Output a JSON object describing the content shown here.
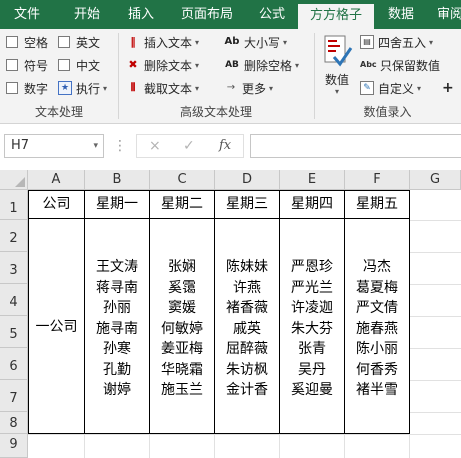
{
  "tabs": [
    "文件",
    "开始",
    "插入",
    "页面布局",
    "公式",
    "方方格子",
    "数据",
    "审阅"
  ],
  "active_tab": "方方格子",
  "ribbon": {
    "text_processing": {
      "checkboxes": [
        "空格",
        "英文",
        "符号",
        "中文",
        "数字"
      ],
      "execute_label": "执行",
      "group_label": "文本处理"
    },
    "advanced": {
      "insert_text": "插入文本",
      "delete_text": "删除文本",
      "cut_text": "截取文本",
      "case_label": "大小写",
      "delete_spaces": "删除空格",
      "more_label": "更多",
      "group_label": "高级文本处理"
    },
    "numeric": {
      "numeric_label": "数值",
      "round_label": "四舍五入",
      "keep_values": "只保留数值",
      "custom_label": "自定义",
      "plus_label": "+",
      "group_label": "数值录入"
    }
  },
  "formula_bar": {
    "name_box": "H7",
    "cancel_icon": "×",
    "enter_icon": "✓",
    "fx_label": "fx",
    "formula": ""
  },
  "columns": [
    "A",
    "B",
    "C",
    "D",
    "E",
    "F",
    "G"
  ],
  "rows": [
    "1",
    "2",
    "3",
    "4",
    "5",
    "6",
    "7",
    "8",
    "9"
  ],
  "table": {
    "headers": [
      "公司",
      "星期一",
      "星期二",
      "星期三",
      "星期四",
      "星期五"
    ],
    "company": "一公司",
    "schedule": [
      [
        "王文涛",
        "蒋寻南",
        "孙丽",
        "施寻南",
        "孙寒",
        "孔勤",
        "谢婷"
      ],
      [
        "张娴",
        "奚霭",
        "窦媛",
        "何敏婷",
        "姜亚梅",
        "华晓霜",
        "施玉兰"
      ],
      [
        "陈妹妹",
        "许燕",
        "褚香薇",
        "戚英",
        "屈醉薇",
        "朱访枫",
        "金计香"
      ],
      [
        "严恩珍",
        "严光兰",
        "许凌迦",
        "朱大芬",
        "张青",
        "吴丹",
        "奚迎曼"
      ],
      [
        "冯杰",
        "葛夏梅",
        "严文倩",
        "施春燕",
        "陈小丽",
        "何香秀",
        "褚半雪"
      ]
    ]
  }
}
